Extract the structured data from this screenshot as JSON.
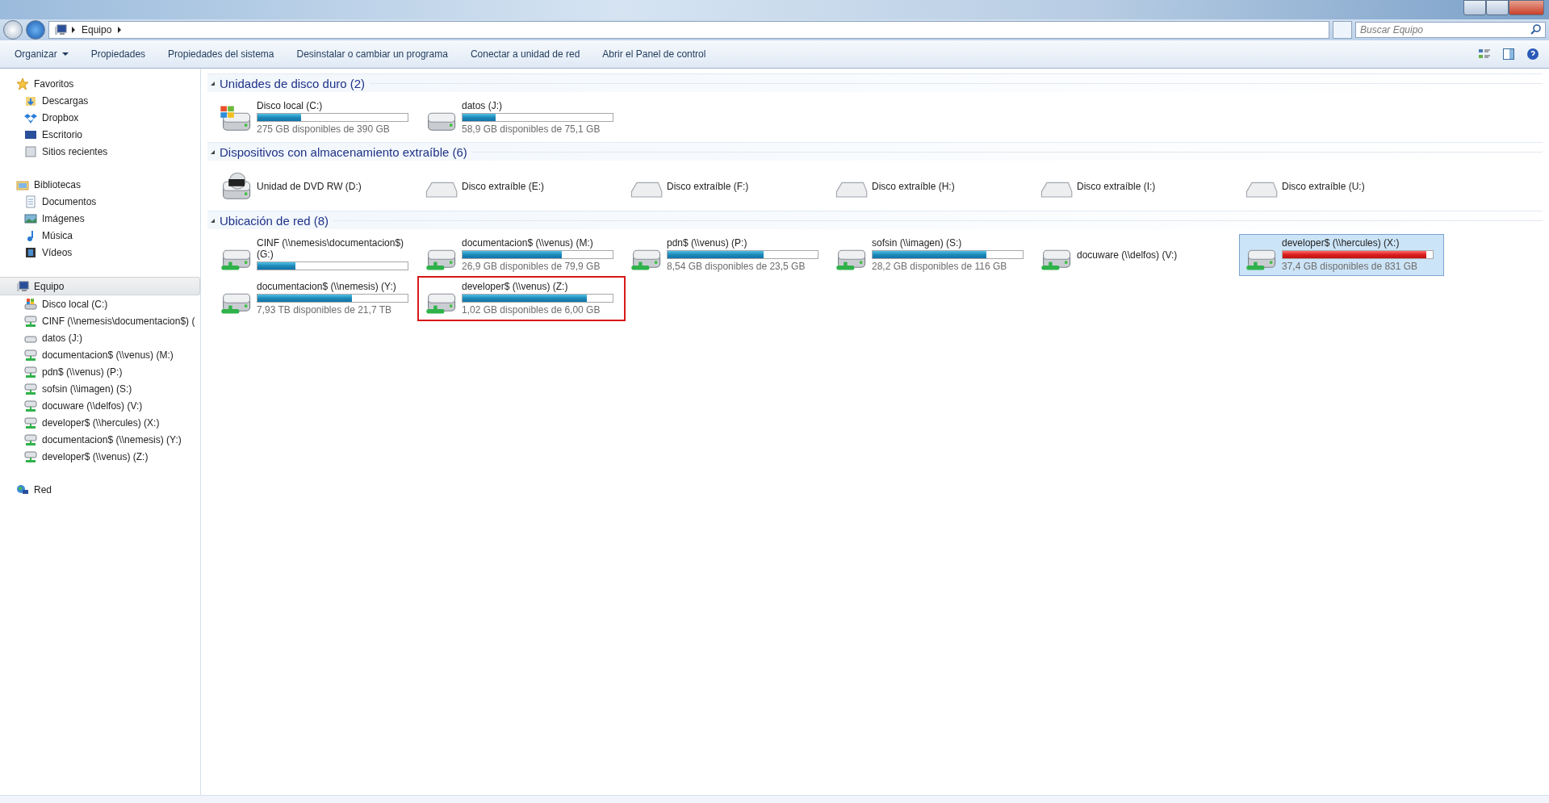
{
  "address_bar": {
    "crumbs": [
      "Equipo"
    ],
    "search_placeholder": "Buscar Equipo"
  },
  "toolbar": {
    "buttons": [
      {
        "label": "Organizar",
        "dropdown": true
      },
      {
        "label": "Propiedades",
        "dropdown": false
      },
      {
        "label": "Propiedades del sistema",
        "dropdown": false
      },
      {
        "label": "Desinstalar o cambiar un programa",
        "dropdown": false
      },
      {
        "label": "Conectar a unidad de red",
        "dropdown": false
      },
      {
        "label": "Abrir el Panel de control",
        "dropdown": false
      }
    ]
  },
  "sidebar": {
    "groups": [
      {
        "label": "Favoritos",
        "kind": "star",
        "selected": false,
        "children": [
          {
            "label": "Descargas",
            "kind": "download"
          },
          {
            "label": "Dropbox",
            "kind": "dropbox"
          },
          {
            "label": "Escritorio",
            "kind": "desktop"
          },
          {
            "label": "Sitios recientes",
            "kind": "recent"
          }
        ]
      },
      {
        "label": "Bibliotecas",
        "kind": "library",
        "selected": false,
        "children": [
          {
            "label": "Documentos",
            "kind": "document"
          },
          {
            "label": "Imágenes",
            "kind": "image"
          },
          {
            "label": "Música",
            "kind": "music"
          },
          {
            "label": "Vídeos",
            "kind": "video"
          }
        ]
      },
      {
        "label": "Equipo",
        "kind": "computer",
        "selected": true,
        "children": [
          {
            "label": "Disco local (C:)",
            "kind": "hdd-windows"
          },
          {
            "label": "CINF (\\\\nemesis\\documentacion$) (",
            "kind": "network"
          },
          {
            "label": "datos (J:)",
            "kind": "hdd"
          },
          {
            "label": "documentacion$ (\\\\venus) (M:)",
            "kind": "network"
          },
          {
            "label": "pdn$ (\\\\venus) (P:)",
            "kind": "network"
          },
          {
            "label": "sofsin (\\\\imagen) (S:)",
            "kind": "network"
          },
          {
            "label": "docuware (\\\\delfos) (V:)",
            "kind": "network"
          },
          {
            "label": "developer$ (\\\\hercules) (X:)",
            "kind": "network"
          },
          {
            "label": "documentacion$ (\\\\nemesis) (Y:)",
            "kind": "network"
          },
          {
            "label": "developer$ (\\\\venus) (Z:)",
            "kind": "network"
          }
        ]
      },
      {
        "label": "Red",
        "kind": "globe",
        "selected": false
      }
    ]
  },
  "sections": [
    {
      "title": "Unidades de disco duro (2)",
      "expanded": true,
      "drives": [
        {
          "name": "Disco local (C:)",
          "kind": "hdd-windows",
          "level": 0.29,
          "warning": false,
          "space": "275 GB disponibles de 390 GB",
          "selected": false,
          "highlighted": false
        },
        {
          "name": "datos (J:)",
          "kind": "hdd",
          "level": 0.22,
          "warning": false,
          "space": "58,9 GB disponibles de 75,1 GB",
          "selected": false,
          "highlighted": false
        }
      ]
    },
    {
      "title": "Dispositivos con almacenamiento extraíble (6)",
      "expanded": true,
      "drives": [
        {
          "name": "Unidad de DVD RW (D:)",
          "kind": "dvd",
          "selected": false,
          "highlighted": false
        },
        {
          "name": "Disco extraíble (E:)",
          "kind": "removable",
          "selected": false,
          "highlighted": false
        },
        {
          "name": "Disco extraíble (F:)",
          "kind": "removable",
          "selected": false,
          "highlighted": false
        },
        {
          "name": "Disco extraíble (H:)",
          "kind": "removable",
          "selected": false,
          "highlighted": false
        },
        {
          "name": "Disco extraíble (I:)",
          "kind": "removable",
          "selected": false,
          "highlighted": false
        },
        {
          "name": "Disco extraíble (U:)",
          "kind": "removable",
          "selected": false,
          "highlighted": false
        }
      ]
    },
    {
      "title": "Ubicación de red (8)",
      "expanded": true,
      "drives": [
        {
          "name": "CINF (\\\\nemesis\\documentacion$) (G:)",
          "kind": "network",
          "level": 0.25,
          "warning": false,
          "selected": false,
          "highlighted": false
        },
        {
          "name": "documentacion$ (\\\\venus) (M:)",
          "kind": "network",
          "level": 0.66,
          "warning": false,
          "space": "26,9 GB disponibles de 79,9 GB",
          "selected": false,
          "highlighted": false
        },
        {
          "name": "pdn$ (\\\\venus) (P:)",
          "kind": "network",
          "level": 0.64,
          "warning": false,
          "space": "8,54 GB disponibles de 23,5 GB",
          "selected": false,
          "highlighted": false
        },
        {
          "name": "sofsin (\\\\imagen) (S:)",
          "kind": "network",
          "level": 0.76,
          "warning": false,
          "space": "28,2 GB disponibles de 116 GB",
          "selected": false,
          "highlighted": false
        },
        {
          "name": "docuware (\\\\delfos) (V:)",
          "kind": "network",
          "selected": false,
          "highlighted": false
        },
        {
          "name": "developer$ (\\\\hercules) (X:)",
          "kind": "network",
          "level": 0.955,
          "warning": true,
          "space": "37,4 GB disponibles de 831 GB",
          "selected": true,
          "highlighted": false
        },
        {
          "name": "documentacion$ (\\\\nemesis) (Y:)",
          "kind": "network",
          "level": 0.63,
          "warning": false,
          "space": "7,93 TB disponibles de 21,7 TB",
          "selected": false,
          "highlighted": false
        },
        {
          "name": "developer$ (\\\\venus) (Z:)",
          "kind": "network",
          "level": 0.83,
          "warning": false,
          "space": "1,02 GB disponibles de 6,00 GB",
          "selected": false,
          "highlighted": true
        }
      ]
    }
  ]
}
